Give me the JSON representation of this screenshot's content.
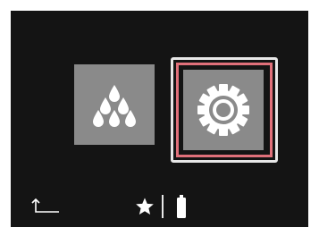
{
  "screen": {
    "background": "#141414"
  },
  "menu": {
    "items": [
      {
        "name": "water",
        "icon": "water-drops-icon",
        "selected": false
      },
      {
        "name": "settings",
        "icon": "gear-icon",
        "selected": true
      }
    ],
    "selection_outer_color": "#e8e8e8",
    "selection_inner_color": "#e0707a",
    "tile_color": "#8a8a8a"
  },
  "status_bar": {
    "back_icon": "back-arrow-icon",
    "favorite_icon": "star-icon",
    "battery_icon": "battery-icon",
    "icon_color": "#ffffff"
  }
}
